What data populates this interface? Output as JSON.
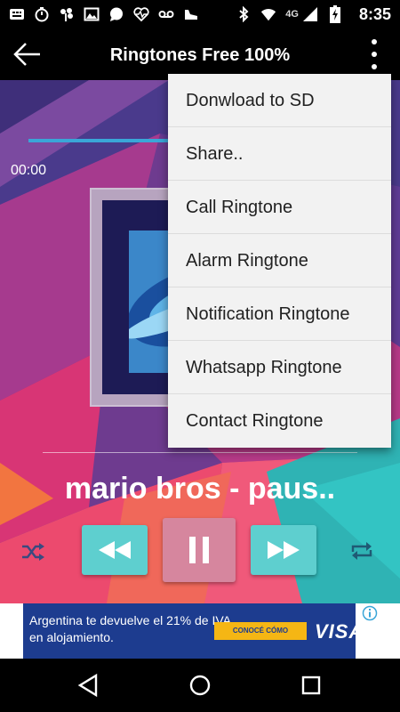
{
  "status_bar": {
    "time": "8:35",
    "network": "4G",
    "icons": [
      "grid-app-icon",
      "stopwatch-icon",
      "tree-icon",
      "image-icon",
      "chat-icon",
      "health-icon",
      "voicemail-icon",
      "shoe-icon",
      "bluetooth-icon",
      "wifi-icon",
      "signal-icon",
      "battery-charging-icon"
    ]
  },
  "app_bar": {
    "title": "Ringtones Free 100%",
    "back_icon": "arrow-left-icon",
    "overflow_icon": "more-vert-icon"
  },
  "player": {
    "time_elapsed": "00:00",
    "progress": 0.48,
    "song_title": "mario bros - paus..",
    "controls": {
      "shuffle_icon": "shuffle-icon",
      "rewind_icon": "rewind-icon",
      "pause_icon": "pause-icon",
      "fast_forward_icon": "fast-forward-icon",
      "repeat_icon": "repeat-icon"
    },
    "colors": {
      "progress_fill": "#3aa6d8",
      "control_teal": "#5ecfcf",
      "control_pink": "#d6869e"
    }
  },
  "menu": {
    "items": [
      "Donwload to SD",
      "Share..",
      "Call Ringtone",
      "Alarm Ringtone",
      "Notification Ringtone",
      "Whatsapp Ringtone",
      "Contact Ringtone"
    ]
  },
  "ad": {
    "text": "Argentina te devuelve el 21% de IVA en alojamiento.",
    "cta": "CONOCÉ CÓMO",
    "brand": "VISA",
    "info_icon": "info-icon",
    "colors": {
      "background": "#1d3c8f",
      "cta": "#f5b614"
    }
  },
  "nav_bar": {
    "back_icon": "triangle-back-icon",
    "home_icon": "circle-home-icon",
    "recents_icon": "square-recents-icon"
  }
}
